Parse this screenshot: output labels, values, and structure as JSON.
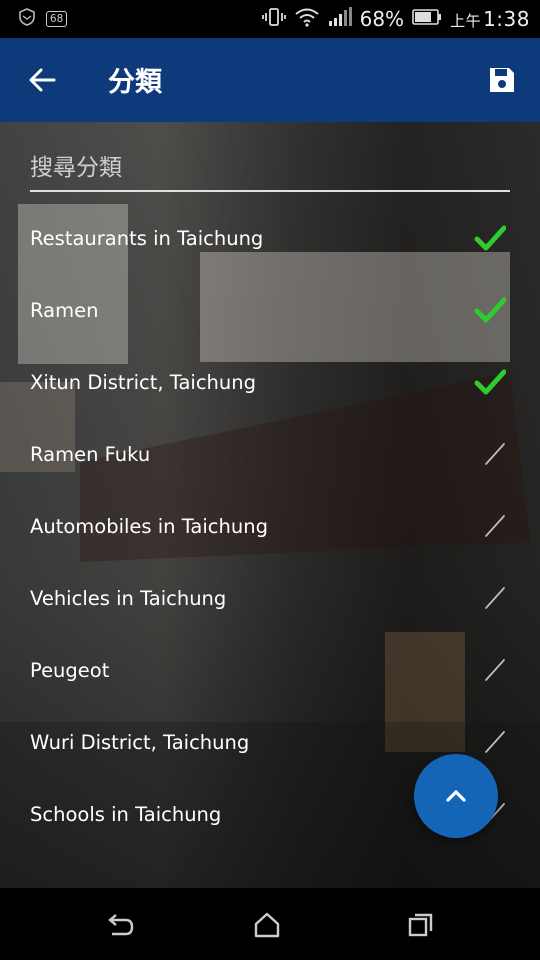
{
  "status_bar": {
    "notification_badge": "68",
    "battery_percent": "68%",
    "time_prefix": "上午",
    "time": "1:38"
  },
  "app_bar": {
    "title": "分類",
    "back_icon": "arrow-left-icon",
    "save_icon": "floppy-disk-icon",
    "color": "#0d3a7a"
  },
  "search": {
    "placeholder": "搜尋分類"
  },
  "categories": [
    {
      "label": "Restaurants in Taichung",
      "checked": true
    },
    {
      "label": "Ramen",
      "checked": true
    },
    {
      "label": "Xitun District, Taichung",
      "checked": true
    },
    {
      "label": "Ramen Fuku",
      "checked": false
    },
    {
      "label": "Automobiles in Taichung",
      "checked": false
    },
    {
      "label": "Vehicles in Taichung",
      "checked": false
    },
    {
      "label": "Peugeot",
      "checked": false
    },
    {
      "label": "Wuri District, Taichung",
      "checked": false
    },
    {
      "label": "Schools in Taichung",
      "checked": false
    }
  ],
  "fab": {
    "icon": "chevron-up-icon",
    "color": "#1565b6"
  },
  "colors": {
    "check_on": "#2ecc2e",
    "check_off": "#d8d8d8"
  }
}
